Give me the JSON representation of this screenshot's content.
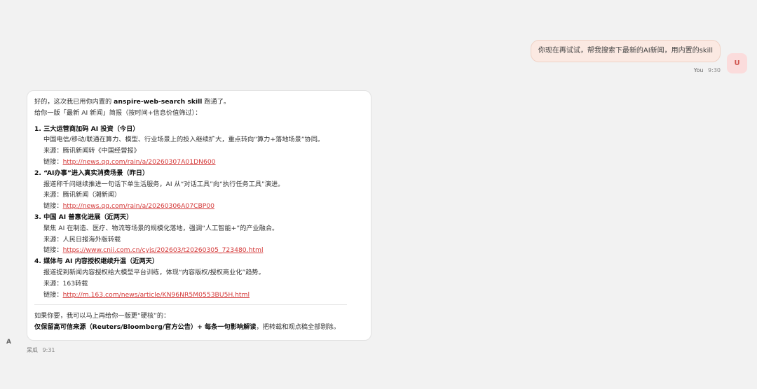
{
  "user_message": {
    "text": "你现在再试试，帮我搜索下最新的AI新闻，用内置的skill",
    "sender": "You",
    "time": "9:30",
    "avatar_letter": "U"
  },
  "assistant_message": {
    "intro_line1_a": "好的，这次我已用你内置的 ",
    "intro_line1_b": "anspire-web-search skill",
    "intro_line1_c": " 跑通了。",
    "intro_line2": "给你一版「最新 AI 新闻」简报（按时间+信息价值筛过）：",
    "items": [
      {
        "title": "1. 三大运营商加码 AI 投资（今日）",
        "summary": "中国电信/移动/联通在算力、模型、行业场景上的投入继续扩大，重点转向“算力+落地场景”协同。",
        "source": "来源：腾讯新闻转《中国经营报》",
        "link_label": "链接：",
        "link": "http://news.qq.com/rain/a/20260307A01DN600"
      },
      {
        "title": "2. “AI办事”进入真实消费场景（昨日）",
        "summary": "报道称千问继续推进一句话下单生活服务，AI 从“对话工具”向“执行任务工具”演进。",
        "source": "来源：腾讯新闻（潮新闻）",
        "link_label": "链接：",
        "link": "http://news.qq.com/rain/a/20260306A07CBP00"
      },
      {
        "title": "3. 中国 AI 普惠化进展（近两天）",
        "summary": "聚焦 AI 在制造、医疗、物流等场景的规模化落地，强调“人工智能+”的产业融合。",
        "source": "来源：人民日报海外版转载",
        "link_label": "链接：",
        "link": "https://www.cnii.com.cn/cyjs/202603/t20260305_723480.html"
      },
      {
        "title": "4. 媒体与 AI 内容授权继续升温（近两天）",
        "summary": "报道提到新闻内容授权给大模型平台训练，体现“内容版权/授权商业化”趋势。",
        "source": "来源：163转载",
        "link_label": "链接：",
        "link": "http://m.163.com/news/article/KN96NR5M0553BU5H.html"
      }
    ],
    "footer_line1": "如果你要，我可以马上再给你一版更“硬核”的：",
    "footer_line2_bold": "仅保留高可信来源（Reuters/Bloomberg/官方公告）+ 每条一句影响解读",
    "footer_line2_rest": "，把转载和观点稿全部剔除。",
    "sender": "呆瓜",
    "time": "9:31",
    "avatar_letter": "A"
  }
}
